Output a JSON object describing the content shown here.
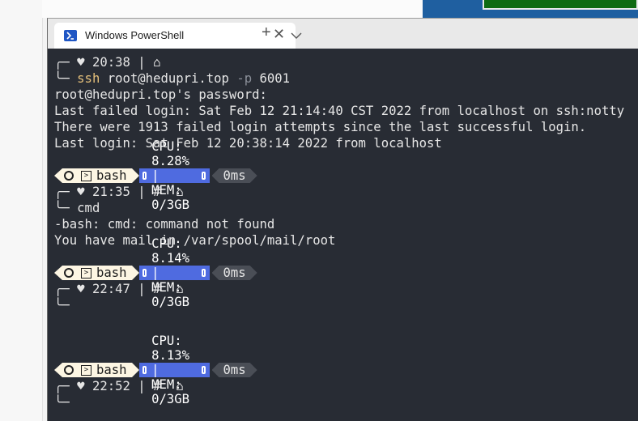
{
  "window": {
    "tab_title": "Windows PowerShell",
    "tab_close": "✕",
    "new_tab": "+"
  },
  "terminal": {
    "block1": {
      "time": "20:38",
      "command": "ssh",
      "host": "root@hedupri.top",
      "flag": "-p",
      "port": "6001",
      "out1": "root@hedupri.top's password:",
      "out2": "Last failed login: Sat Feb 12 21:14:40 CST 2022 from localhost on ssh:notty",
      "out3": "There were 1913 failed login attempts since the last successful login.",
      "out4": "Last login: Sat Feb 12 20:38:14 2022 from localhost"
    },
    "bar1": {
      "shell": "bash",
      "cpu": "CPU: 8.28% | MEM: 0/3GB",
      "elapsed": "0ms"
    },
    "block2": {
      "time": "21:35",
      "command": "cmd",
      "out1": "-bash: cmd: command not found",
      "out2": "You have mail in /var/spool/mail/root"
    },
    "bar2": {
      "shell": "bash",
      "cpu": "CPU: 8.14% | MEM: 0/3GB",
      "elapsed": "0ms"
    },
    "block3": {
      "time": "22:47"
    },
    "bar3": {
      "shell": "bash",
      "cpu": "CPU: 8.13% | MEM: 0/3GB",
      "elapsed": "0ms"
    },
    "block4": {
      "time": "22:52"
    }
  },
  "colors": {
    "terminal_bg": "#282c34",
    "cpu_segment": "#4f6be0",
    "shell_segment": "#fdf6e3",
    "time_segment": "#4a4e56"
  }
}
